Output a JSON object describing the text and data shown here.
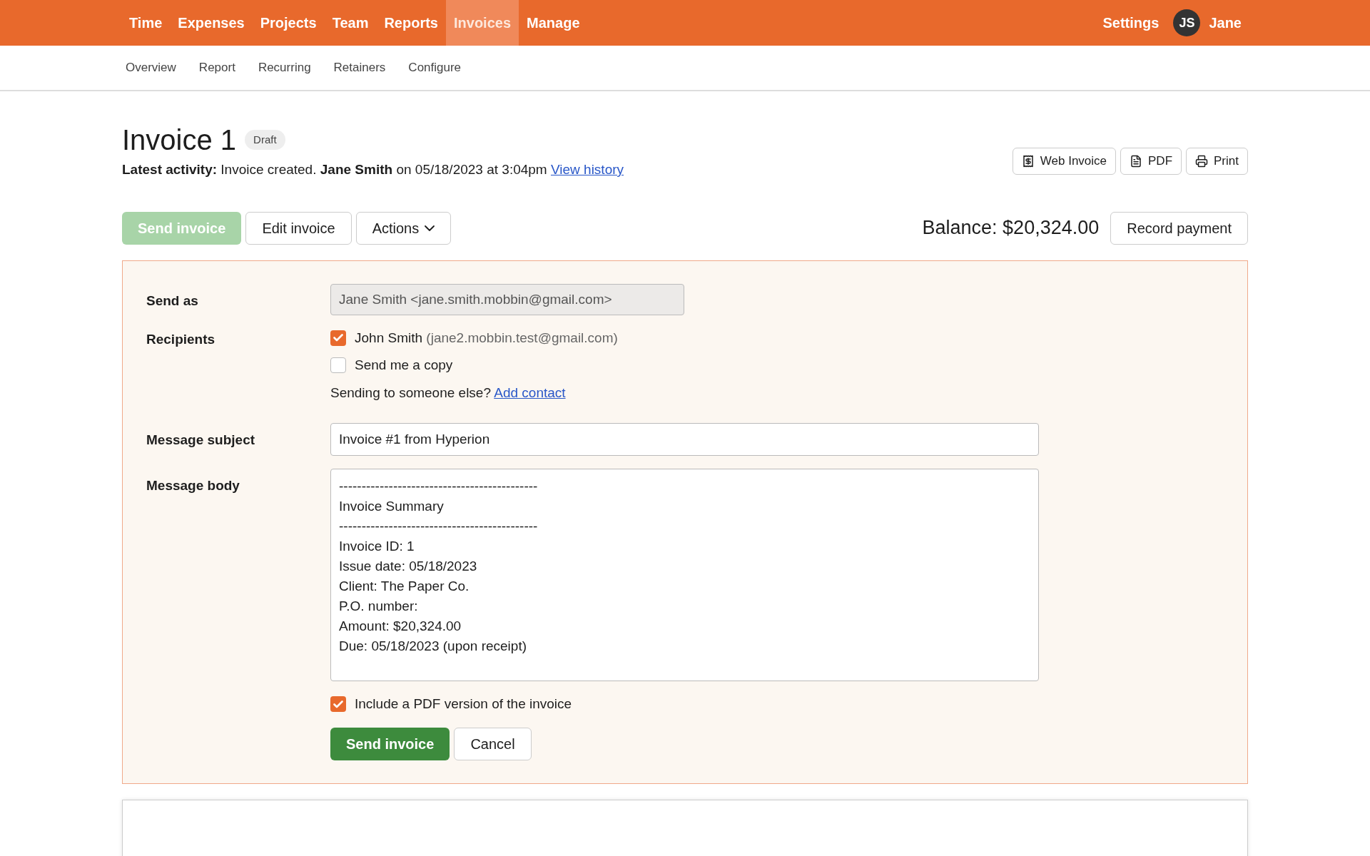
{
  "nav": {
    "items": [
      {
        "label": "Time",
        "selected": false
      },
      {
        "label": "Expenses",
        "selected": false
      },
      {
        "label": "Projects",
        "selected": false
      },
      {
        "label": "Team",
        "selected": false
      },
      {
        "label": "Reports",
        "selected": false
      },
      {
        "label": "Invoices",
        "selected": true
      },
      {
        "label": "Manage",
        "selected": false
      }
    ],
    "settings": "Settings",
    "avatar": "JS",
    "user": "Jane"
  },
  "subnav": [
    "Overview",
    "Report",
    "Recurring",
    "Retainers",
    "Configure"
  ],
  "header": {
    "title": "Invoice 1",
    "badge": "Draft",
    "activity": "**Latest activity:** Invoice created. **Jane Smith** on 05/18/2023 at 3:04pm",
    "history_link": "View history",
    "tools": [
      "Web Invoice",
      "PDF",
      "Print"
    ]
  },
  "actions": {
    "send": {
      "label": "Send invoice",
      "disabled": true
    },
    "edit": "Edit invoice",
    "more": "Actions",
    "balance": "Balance: $20,324.00",
    "record": "Record payment"
  },
  "form": {
    "send_as_label": "Send as",
    "send_as": "Jane Smith <jane.smith.mobbin@gmail.com>",
    "recipients_label": "Recipients",
    "recipients": [
      {
        "name": "John Smith",
        "email": "(jane2.mobbin.test@gmail.com)",
        "checked": true
      },
      {
        "name": "Send me a copy",
        "checked": false
      }
    ],
    "someone_else": "Sending to someone else?",
    "add_contact": "Add contact",
    "subject_label": "Message subject",
    "subject": "Invoice #1 from Hyperion",
    "body_label": "Message body",
    "body": [
      "--------------------------------------------",
      "Invoice Summary",
      "--------------------------------------------",
      "Invoice ID: 1",
      "Issue date: 05/18/2023",
      "Client: The Paper Co.",
      "P.O. number:",
      "Amount: $20,324.00",
      "Due: 05/18/2023 (upon receipt)"
    ],
    "include_pdf": {
      "label": "Include a PDF version of the invoice",
      "checked": true
    },
    "submit": "Send invoice",
    "cancel": "Cancel"
  }
}
